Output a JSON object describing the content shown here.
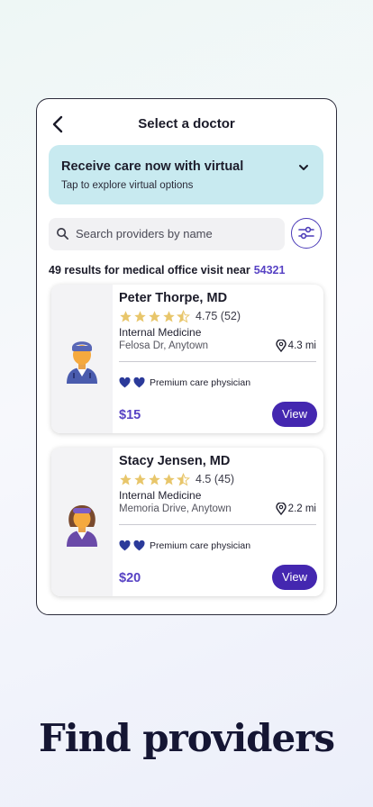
{
  "header": {
    "title": "Select a doctor"
  },
  "banner": {
    "title": "Receive care now with virtual",
    "subtitle": "Tap to explore virtual options"
  },
  "search": {
    "placeholder": "Search providers by name"
  },
  "results": {
    "text": "49 results for medical office visit near",
    "zip": "54321"
  },
  "doctors": [
    {
      "name": "Peter Thorpe, MD",
      "rating": "4.75 (52)",
      "stars": 4.75,
      "specialty": "Internal Medicine",
      "address": "Felosa Dr, Anytown",
      "distance": "4.3 mi",
      "badge": "Premium care physician",
      "price": "$15",
      "action": "View"
    },
    {
      "name": "Stacy Jensen, MD",
      "rating": "4.5 (45)",
      "stars": 4.5,
      "specialty": "Internal Medicine",
      "address": "Memoria Drive, Anytown",
      "distance": "2.2 mi",
      "badge": "Premium care physician",
      "price": "$20",
      "action": "View"
    }
  ],
  "footer": {
    "headline": "Find providers"
  },
  "colors": {
    "accent": "#4427b0",
    "banner": "#c8eaf0",
    "star": "#e8c66b",
    "heart": "#2b3a9a"
  }
}
